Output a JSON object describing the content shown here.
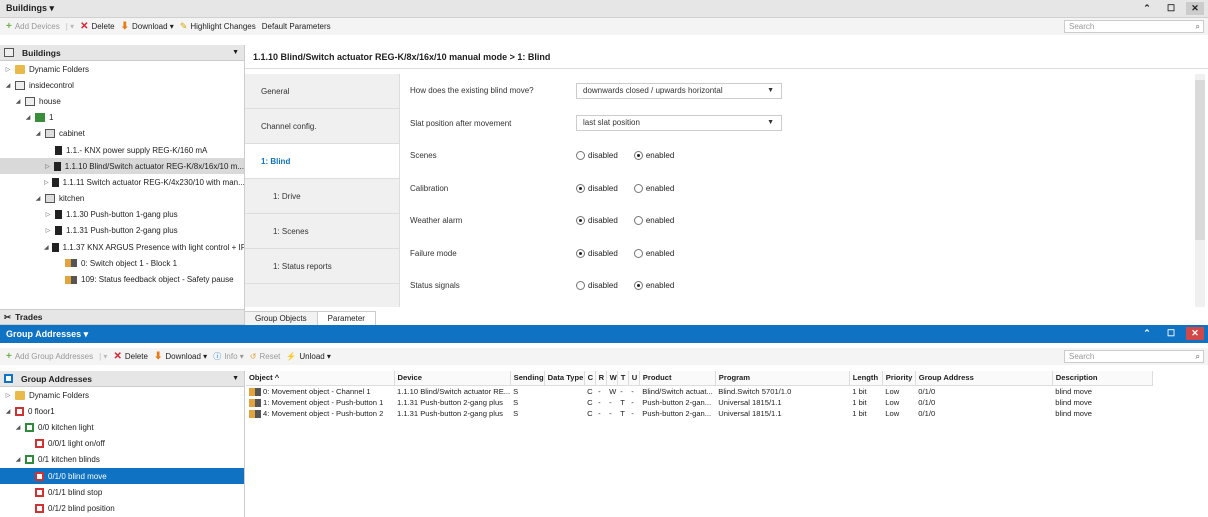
{
  "top_window": {
    "title": "Buildings ▾",
    "toolbar": {
      "add_devices": "Add Devices",
      "delete": "Delete",
      "download": "Download ▾",
      "highlight": "Highlight Changes",
      "default_params": "Default Parameters",
      "search_placeholder": "Search"
    },
    "tree_header": "Buildings",
    "tree": [
      {
        "label": "Dynamic Folders",
        "indent": 0,
        "toggle": "▷",
        "icon": "folder"
      },
      {
        "label": "insidecontrol",
        "indent": 0,
        "toggle": "◢",
        "icon": "bld"
      },
      {
        "label": "house",
        "indent": 1,
        "toggle": "◢",
        "icon": "bld"
      },
      {
        "label": "1",
        "indent": 2,
        "toggle": "◢",
        "icon": "floor"
      },
      {
        "label": "cabinet",
        "indent": 3,
        "toggle": "◢",
        "icon": "room"
      },
      {
        "label": "1.1.- KNX power supply REG-K/160 mA",
        "indent": 4,
        "toggle": "",
        "icon": "dev"
      },
      {
        "label": "1.1.10 Blind/Switch actuator REG-K/8x/16x/10 m...",
        "indent": 4,
        "toggle": "▷",
        "icon": "dev",
        "selected": true
      },
      {
        "label": "1.1.11 Switch actuator REG-K/4x230/10 with man...",
        "indent": 4,
        "toggle": "▷",
        "icon": "dev"
      },
      {
        "label": "kitchen",
        "indent": 3,
        "toggle": "◢",
        "icon": "room"
      },
      {
        "label": "1.1.30 Push-button 1-gang plus",
        "indent": 4,
        "toggle": "▷",
        "icon": "dev"
      },
      {
        "label": "1.1.31 Push-button 2-gang plus",
        "indent": 4,
        "toggle": "▷",
        "icon": "dev"
      },
      {
        "label": "1.1.37 KNX ARGUS Presence with light control + IR",
        "indent": 4,
        "toggle": "◢",
        "icon": "dev"
      },
      {
        "label": "0: Switch object 1 - Block 1",
        "indent": 5,
        "toggle": "",
        "icon": "obj"
      },
      {
        "label": "109: Status feedback object - Safety pause",
        "indent": 5,
        "toggle": "",
        "icon": "obj"
      }
    ],
    "trades_label": "Trades",
    "param_title": "1.1.10 Blind/Switch actuator REG-K/8x/16x/10 manual mode > 1: Blind",
    "nav": [
      "General",
      "Channel config.",
      "1: Blind",
      "1: Drive",
      "1: Scenes",
      "1: Status reports"
    ],
    "nav_active": 2,
    "params": [
      {
        "label": "How does the existing blind move?",
        "type": "dropdown",
        "value": "downwards closed / upwards horizontal"
      },
      {
        "label": "Slat position after movement",
        "type": "dropdown",
        "value": "last slat position"
      },
      {
        "label": "Scenes",
        "type": "radio",
        "value": "enabled"
      },
      {
        "label": "Calibration",
        "type": "radio",
        "value": "disabled"
      },
      {
        "label": "Weather alarm",
        "type": "radio",
        "value": "disabled"
      },
      {
        "label": "Failure mode",
        "type": "radio",
        "value": "disabled"
      },
      {
        "label": "Status signals",
        "type": "radio",
        "value": "enabled"
      }
    ],
    "radio_labels": {
      "disabled": "disabled",
      "enabled": "enabled"
    },
    "bottom_tabs": [
      "Group Objects",
      "Parameter"
    ]
  },
  "bottom_window": {
    "title": "Group Addresses ▾",
    "toolbar": {
      "add_group": "Add Group Addresses",
      "delete": "Delete",
      "download": "Download ▾",
      "info": "Info ▾",
      "reset": "Reset",
      "unload": "Unload ▾",
      "search_placeholder": "Search"
    },
    "tree_header": "Group Addresses",
    "tree": [
      {
        "label": "Dynamic Folders",
        "indent": 0,
        "toggle": "▷",
        "icon": "folder"
      },
      {
        "label": "0 floor1",
        "indent": 0,
        "toggle": "◢",
        "icon": "grp"
      },
      {
        "label": "0/0 kitchen light",
        "indent": 1,
        "toggle": "◢",
        "icon": "grpg"
      },
      {
        "label": "0/0/1 light on/off",
        "indent": 2,
        "toggle": "",
        "icon": "grp"
      },
      {
        "label": "0/1 kitchen blinds",
        "indent": 1,
        "toggle": "◢",
        "icon": "grpg"
      },
      {
        "label": "0/1/0 blind move",
        "indent": 2,
        "toggle": "",
        "icon": "grp",
        "selected": true
      },
      {
        "label": "0/1/1 blind stop",
        "indent": 2,
        "toggle": "",
        "icon": "grp"
      },
      {
        "label": "0/1/2 blind position",
        "indent": 2,
        "toggle": "",
        "icon": "grp"
      }
    ],
    "columns": [
      "Object ^",
      "Device",
      "Sending",
      "Data Type",
      "C",
      "R",
      "W",
      "T",
      "U",
      "Product",
      "Program",
      "Length",
      "Priority",
      "Group Address",
      "Description"
    ],
    "rows": [
      [
        "0: Movement object - Channel 1",
        "1.1.10 Blind/Switch actuator RE...",
        "S",
        "",
        "C",
        "-",
        "W",
        "-",
        "-",
        "Blind/Switch actuat...",
        "Blind.Switch 5701/1.0",
        "1 bit",
        "Low",
        "0/1/0",
        "blind move"
      ],
      [
        "1: Movement object - Push-button 1",
        "1.1.31 Push-button 2-gang plus",
        "S",
        "",
        "C",
        "-",
        "-",
        "T",
        "-",
        "Push-button 2-gan...",
        "Universal 1815/1.1",
        "1 bit",
        "Low",
        "0/1/0",
        "blind move"
      ],
      [
        "4: Movement object - Push-button 2",
        "1.1.31 Push-button 2-gang plus",
        "S",
        "",
        "C",
        "-",
        "-",
        "T",
        "-",
        "Push-button 2-gan...",
        "Universal 1815/1.1",
        "1 bit",
        "Low",
        "0/1/0",
        "blind move"
      ]
    ]
  },
  "colors": {
    "accent": "#0f72c2",
    "red": "#dd2233",
    "green": "#6bb34a"
  }
}
